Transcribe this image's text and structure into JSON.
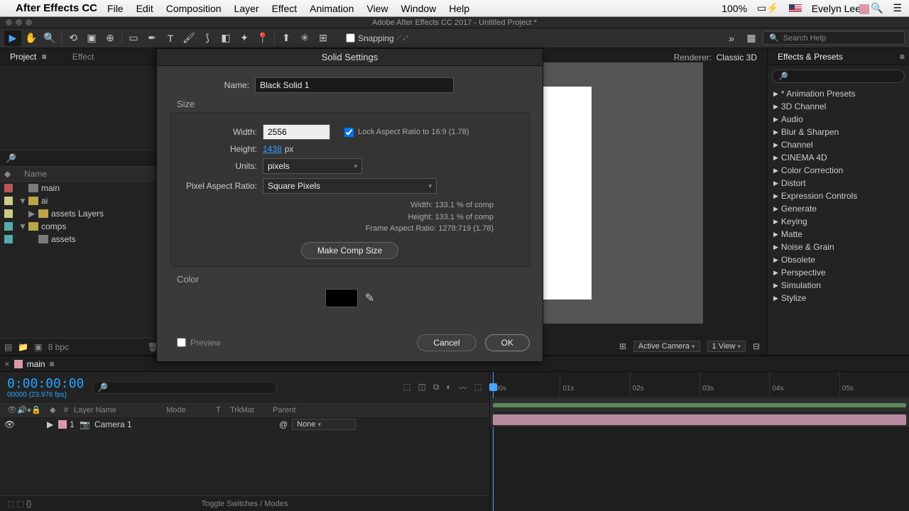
{
  "menubar": {
    "app": "After Effects CC",
    "items": [
      "File",
      "Edit",
      "Composition",
      "Layer",
      "Effect",
      "Animation",
      "View",
      "Window",
      "Help"
    ],
    "battery": "100%",
    "user": "Evelyn Lee"
  },
  "window": {
    "title": "Adobe After Effects CC 2017 - Untitled Project *"
  },
  "toolbar": {
    "snapping": "Snapping",
    "searchHelpPlaceholder": "Search Help"
  },
  "projectPanel": {
    "tabActive": "Project",
    "tabOther": "Effect",
    "colName": "Name",
    "rows": [
      {
        "name": "main",
        "swatch": "sw-red",
        "icon": "comp-icon",
        "indent": 0,
        "arrow": ""
      },
      {
        "name": "ai",
        "swatch": "sw-yellow",
        "icon": "folder-icon",
        "indent": 0,
        "arrow": "▼"
      },
      {
        "name": "assets Layers",
        "swatch": "sw-yellow",
        "icon": "folder-icon",
        "indent": 1,
        "arrow": "▶"
      },
      {
        "name": "comps",
        "swatch": "sw-teal",
        "icon": "folder-icon",
        "indent": 0,
        "arrow": "▼"
      },
      {
        "name": "assets",
        "swatch": "sw-teal",
        "icon": "comp-icon",
        "indent": 1,
        "arrow": ""
      }
    ],
    "bpc": "8 bpc"
  },
  "viewer": {
    "rendererLabel": "Renderer:",
    "rendererValue": "Classic 3D",
    "activeCamera": "Active Camera",
    "view": "1 View"
  },
  "effectsPanel": {
    "title": "Effects & Presets",
    "items": [
      "* Animation Presets",
      "3D Channel",
      "Audio",
      "Blur & Sharpen",
      "Channel",
      "CINEMA 4D",
      "Color Correction",
      "Distort",
      "Expression Controls",
      "Generate",
      "Keying",
      "Matte",
      "Noise & Grain",
      "Obsolete",
      "Perspective",
      "Simulation",
      "Stylize"
    ]
  },
  "timeline": {
    "compName": "main",
    "timecode": "0:00:00:00",
    "timecodeSub": "00000 (23.976 fps)",
    "cols": {
      "num": "#",
      "layerName": "Layer Name",
      "mode": "Mode",
      "t": "T",
      "trkMat": "TrkMat",
      "parent": "Parent"
    },
    "layer": {
      "num": "1",
      "name": "Camera 1",
      "parent": "None"
    },
    "ticks": [
      ":00s",
      "01s",
      "02s",
      "03s",
      "04s",
      "05s"
    ],
    "toggle": "Toggle Switches / Modes"
  },
  "dialog": {
    "title": "Solid Settings",
    "nameLabel": "Name:",
    "nameValue": "Black Solid 1",
    "sizeSection": "Size",
    "widthLabel": "Width:",
    "widthValue": "2556",
    "heightLabel": "Height:",
    "heightValue": "1438",
    "heightUnit": "px",
    "lockAspect": "Lock Aspect Ratio to 16:9 (1.78)",
    "unitsLabel": "Units:",
    "unitsValue": "pixels",
    "parLabel": "Pixel Aspect Ratio:",
    "parValue": "Square Pixels",
    "infoWidth": "Width:  133.1 % of comp",
    "infoHeight": "Height:  133.1 % of comp",
    "infoFar": "Frame Aspect Ratio:  1278:719 (1.78)",
    "makeComp": "Make Comp Size",
    "colorSection": "Color",
    "preview": "Preview",
    "cancel": "Cancel",
    "ok": "OK"
  }
}
